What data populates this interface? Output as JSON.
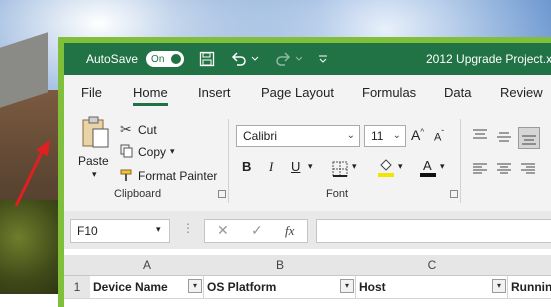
{
  "window": {
    "autosave_label": "AutoSave",
    "autosave_state": "On",
    "document_title": "2012 Upgrade Project.xl",
    "accent_color": "#217346",
    "frame_color": "#7fbf3a"
  },
  "tabs": [
    {
      "label": "File"
    },
    {
      "label": "Home",
      "active": true
    },
    {
      "label": "Insert"
    },
    {
      "label": "Page Layout"
    },
    {
      "label": "Formulas"
    },
    {
      "label": "Data"
    },
    {
      "label": "Review"
    }
  ],
  "clipboard": {
    "paste_label": "Paste",
    "cut_label": "Cut",
    "copy_label": "Copy",
    "format_painter_label": "Format Painter",
    "group_label": "Clipboard"
  },
  "font": {
    "font_name": "Calibri",
    "font_size": "11",
    "bold": "B",
    "italic": "I",
    "underline": "U",
    "group_label": "Font"
  },
  "formula_bar": {
    "name_box": "F10",
    "fx": "fx",
    "formula": ""
  },
  "sheet": {
    "columns": [
      "A",
      "B",
      "C"
    ],
    "row_number": "1",
    "headers": [
      "Device Name",
      "OS Platform",
      "Host",
      "Runnin"
    ]
  }
}
